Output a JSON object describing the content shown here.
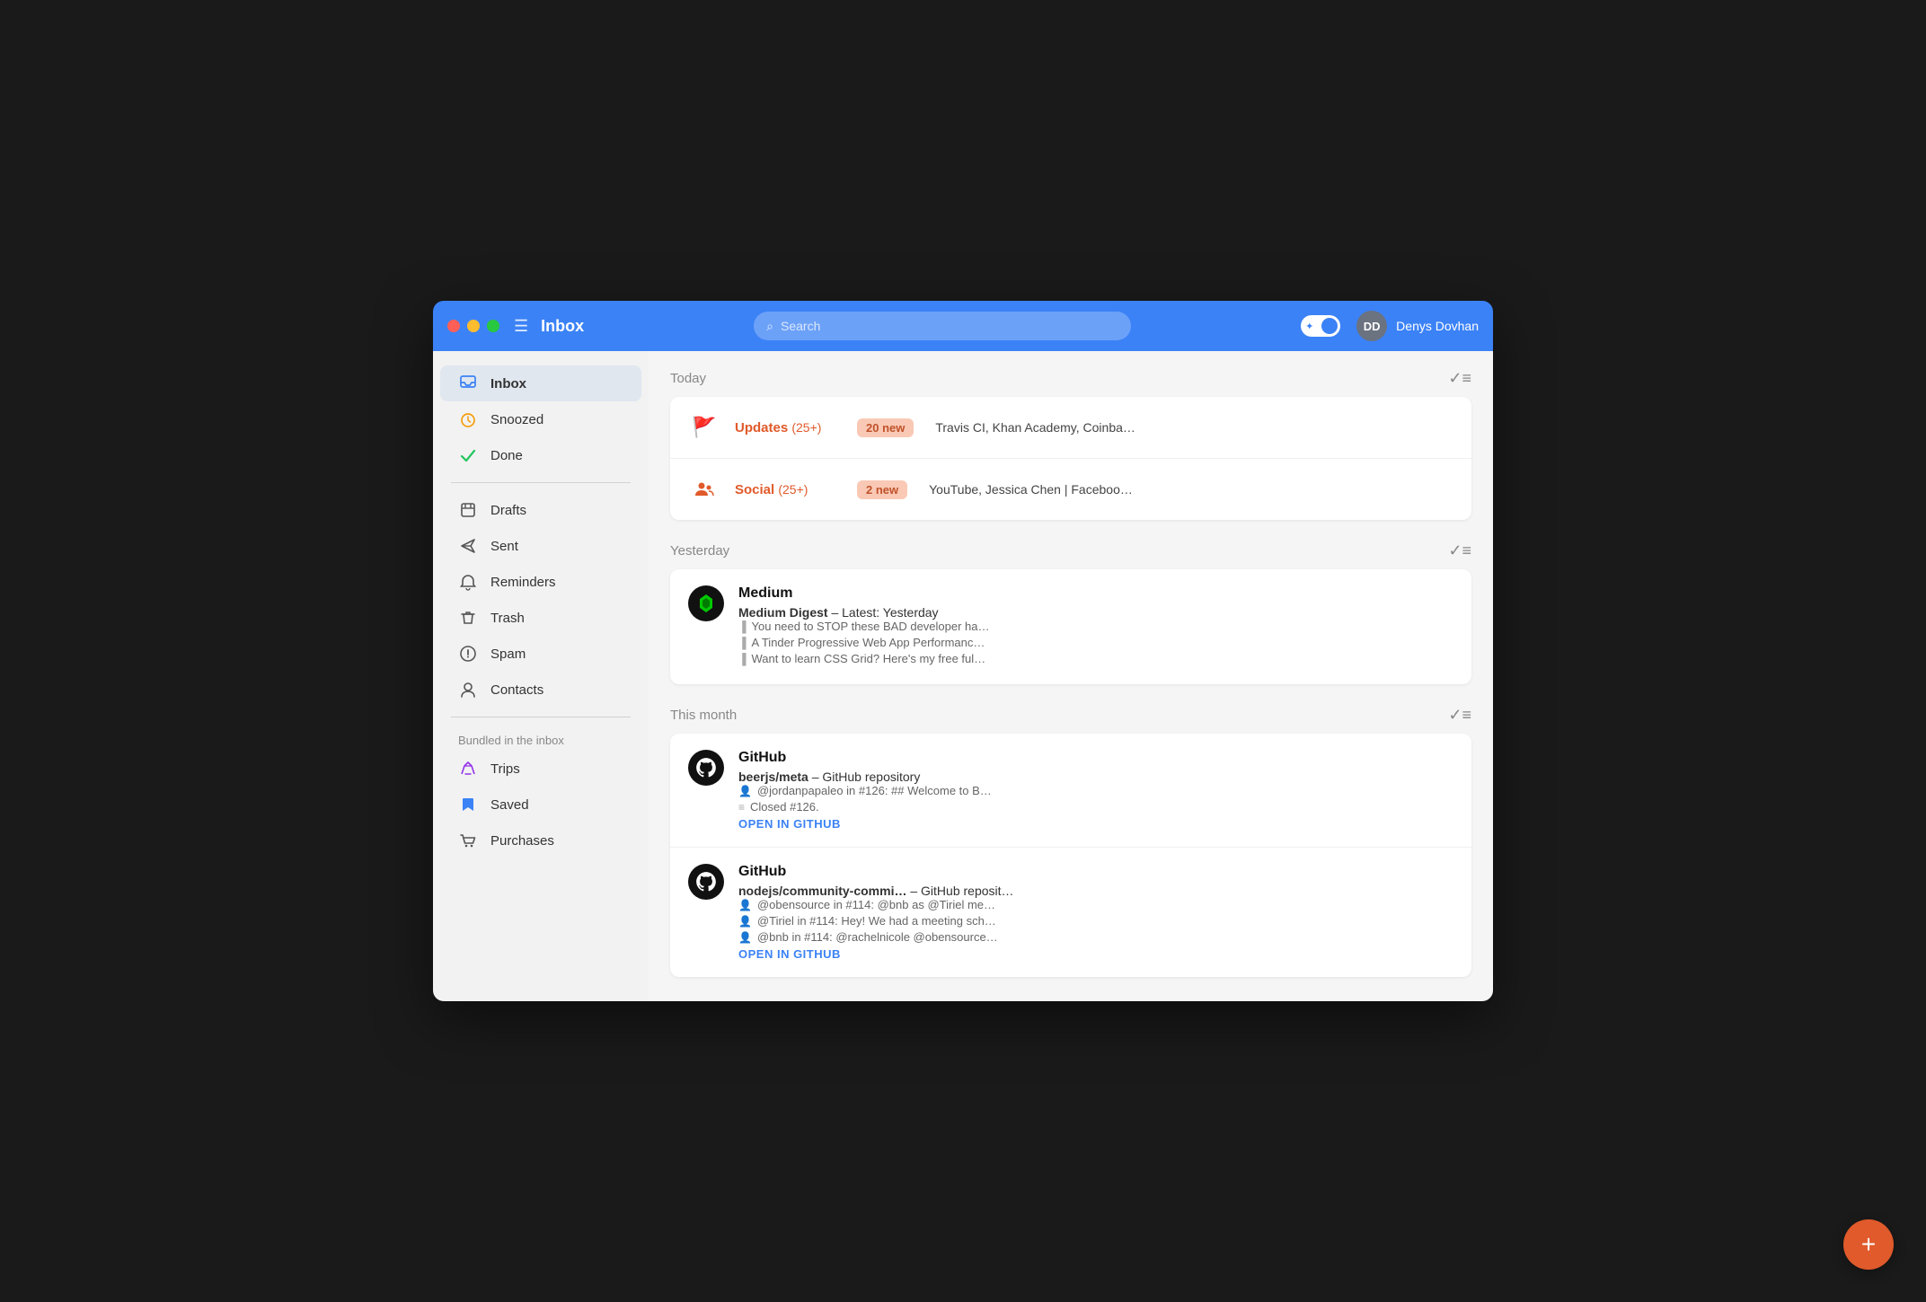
{
  "titlebar": {
    "title": "Inbox",
    "search_placeholder": "Search",
    "user_name": "Denys Dovhan",
    "avatar_initials": "DD"
  },
  "sidebar": {
    "primary_items": [
      {
        "id": "inbox",
        "label": "Inbox",
        "icon": "inbox",
        "active": true
      },
      {
        "id": "snoozed",
        "label": "Snoozed",
        "icon": "clock",
        "active": false
      },
      {
        "id": "done",
        "label": "Done",
        "icon": "check",
        "active": false
      }
    ],
    "secondary_items": [
      {
        "id": "drafts",
        "label": "Drafts",
        "icon": "draft"
      },
      {
        "id": "sent",
        "label": "Sent",
        "icon": "send"
      },
      {
        "id": "reminders",
        "label": "Reminders",
        "icon": "reminder"
      },
      {
        "id": "trash",
        "label": "Trash",
        "icon": "trash"
      },
      {
        "id": "spam",
        "label": "Spam",
        "icon": "spam"
      },
      {
        "id": "contacts",
        "label": "Contacts",
        "icon": "contact"
      }
    ],
    "bundled_label": "Bundled in the inbox",
    "bundled_items": [
      {
        "id": "trips",
        "label": "Trips",
        "icon": "trips"
      },
      {
        "id": "saved",
        "label": "Saved",
        "icon": "saved"
      },
      {
        "id": "purchases",
        "label": "Purchases",
        "icon": "purchases"
      }
    ]
  },
  "content": {
    "sections": [
      {
        "id": "today",
        "title": "Today",
        "rows": [
          {
            "type": "bundle",
            "icon": "flag",
            "icon_color": "#e05a2b",
            "sender": "Updates",
            "count": "(25+)",
            "badge": "20 new",
            "preview": "Travis CI, Khan Academy, Coinba…"
          },
          {
            "type": "bundle",
            "icon": "people",
            "icon_color": "#e05a2b",
            "sender": "Social",
            "count": "(25+)",
            "badge": "2 new",
            "preview": "YouTube, Jessica Chen | Faceboo…"
          }
        ]
      },
      {
        "id": "yesterday",
        "title": "Yesterday",
        "rows": [
          {
            "type": "single",
            "avatar": "medium",
            "sender": "Medium",
            "subject_bold": "Medium Digest",
            "subject_rest": " – Latest: Yesterday",
            "snippets": [
              "You need to STOP these BAD developer ha…",
              "A Tinder Progressive Web App Performanc…",
              "Want to learn CSS Grid? Here's my free ful…"
            ],
            "has_link": false
          }
        ]
      },
      {
        "id": "this_month",
        "title": "This month",
        "rows": [
          {
            "type": "github",
            "sender": "GitHub",
            "repo": "beerjs/meta",
            "repo_rest": " – GitHub repository",
            "snippets": [
              "@jordanpapaleo in #126: ## Welcome to B…",
              "Closed #126."
            ],
            "link_label": "OPEN IN GITHUB"
          },
          {
            "type": "github",
            "sender": "GitHub",
            "repo": "nodejs/community-commi…",
            "repo_rest": " – GitHub reposit…",
            "snippets": [
              "@obensource in #114: @bnb as @Tiriel me…",
              "@Tiriel in #114: Hey! We had a meeting sch…",
              "@bnb in #114: @rachelnicole @obensource…"
            ],
            "link_label": "OPEN IN GITHUB"
          }
        ]
      }
    ],
    "fab_label": "+"
  }
}
